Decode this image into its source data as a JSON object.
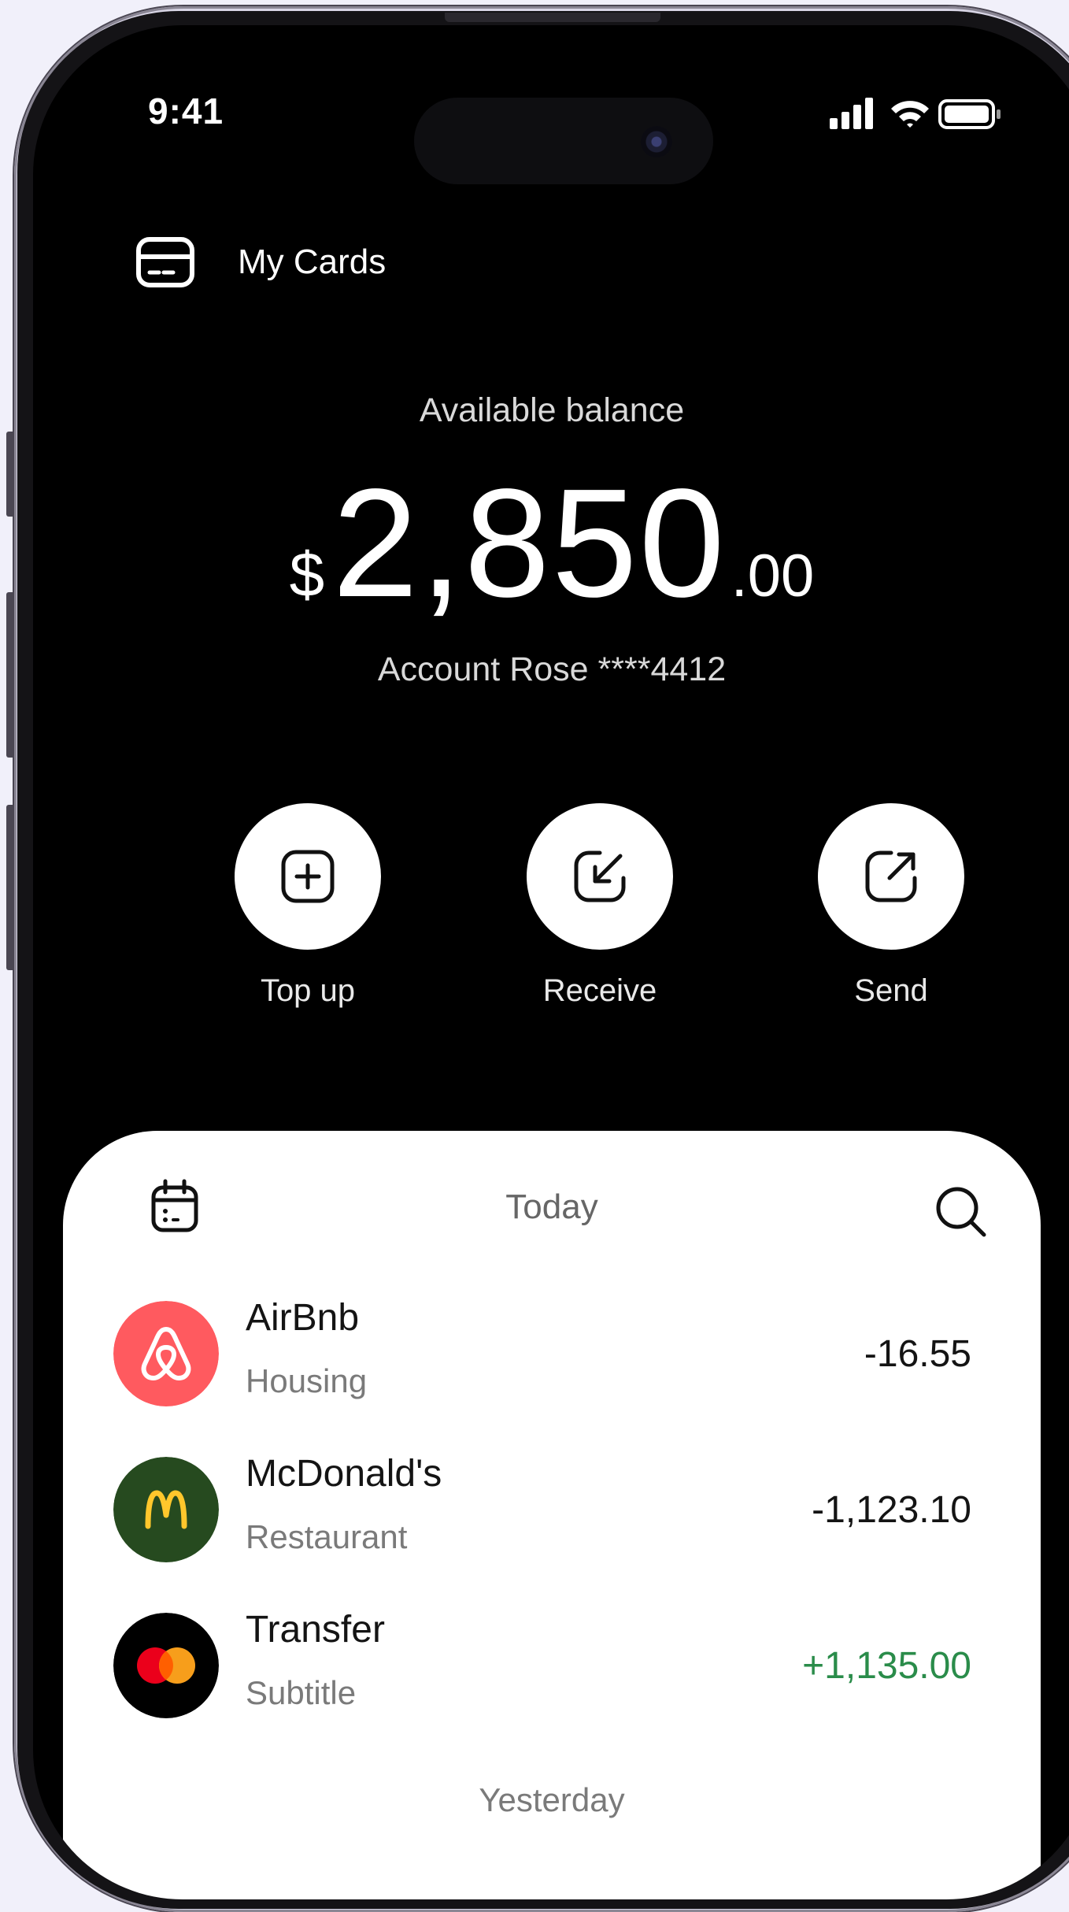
{
  "status_bar": {
    "time": "9:41"
  },
  "header": {
    "title": "My Cards"
  },
  "balance": {
    "label": "Available balance",
    "currency": "$",
    "amount_main": "2,850",
    "amount_cents": ".00",
    "account": "Account Rose ****4412"
  },
  "actions": [
    {
      "label": "Top up",
      "icon": "plus-square-icon"
    },
    {
      "label": "Receive",
      "icon": "arrow-down-left-icon"
    },
    {
      "label": "Send",
      "icon": "arrow-up-right-icon"
    }
  ],
  "transactions_sheet": {
    "title": "Today",
    "items": [
      {
        "name": "AirBnb",
        "subtitle": "Housing",
        "amount": "-16.55",
        "logo": "airbnb-logo",
        "logo_color": "#ff5a5f"
      },
      {
        "name": "McDonald's",
        "subtitle": "Restaurant",
        "amount": "-1,123.10",
        "logo": "mcdonalds-logo",
        "logo_color": "#264a1f"
      },
      {
        "name": "Transfer",
        "subtitle": "Subtitle",
        "amount": "+1,135.00",
        "logo": "mastercard-logo",
        "logo_color": "#000000"
      }
    ],
    "next_section": "Yesterday"
  },
  "colors": {
    "background": "#f1f0fa",
    "screen": "#000000",
    "sheet": "#ffffff",
    "positive_amount": "#2a8c4a"
  }
}
